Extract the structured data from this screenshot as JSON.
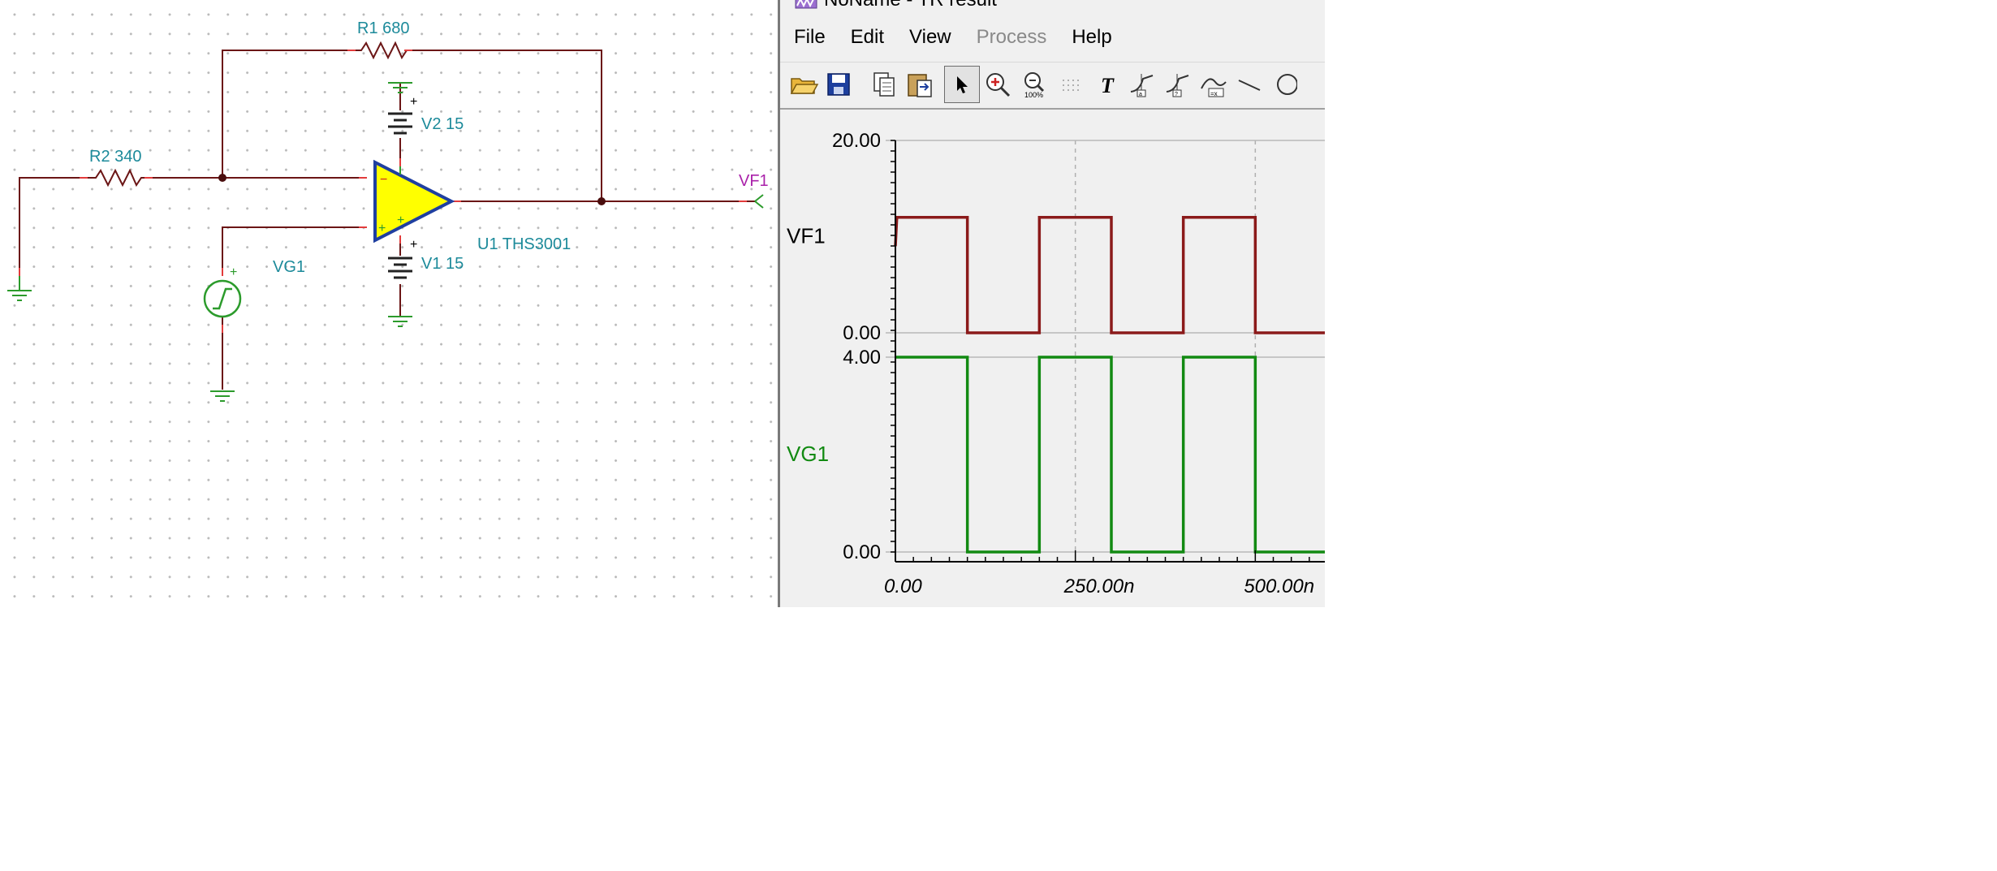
{
  "schematic": {
    "components": {
      "r1": "R1 680",
      "r2": "R2 340",
      "v2": "V2 15",
      "v1": "V1 15",
      "u1": "U1 THS3001",
      "vg1": "VG1",
      "vf1": "VF1"
    }
  },
  "window": {
    "title": "NoName - TR result",
    "menu": [
      {
        "label": "File",
        "enabled": true
      },
      {
        "label": "Edit",
        "enabled": true
      },
      {
        "label": "View",
        "enabled": true
      },
      {
        "label": "Process",
        "enabled": false
      },
      {
        "label": "Help",
        "enabled": true
      }
    ],
    "toolbar": [
      "open-folder-icon",
      "save-icon",
      "copy-icon",
      "paste-icon",
      "pointer-icon",
      "zoom-in-icon",
      "zoom-100-icon",
      "grid-icon",
      "text-icon",
      "cursor-a-icon",
      "cursor-b-icon",
      "cursor-measure-icon",
      "line-icon",
      "circle-icon"
    ]
  },
  "chart_data": {
    "type": "line",
    "xlabel": "",
    "x_tick_labels": [
      "0.00",
      "250.00n",
      "500.00n"
    ],
    "x_ticks": [
      0,
      250,
      500
    ],
    "x_range": [
      0,
      600
    ],
    "series": [
      {
        "name": "VF1",
        "color": "#8b1a1a",
        "y_tick_labels": [
          "0.00",
          "20.00"
        ],
        "ylim": [
          0,
          20
        ],
        "x": [
          0,
          2,
          2,
          100,
          100,
          200,
          200,
          300,
          300,
          400,
          400,
          500,
          500,
          600
        ],
        "y": [
          9,
          12,
          12,
          12,
          0,
          0,
          12,
          12,
          0,
          0,
          12,
          12,
          0,
          0
        ]
      },
      {
        "name": "VG1",
        "color": "#128a12",
        "y_tick_labels": [
          "0.00",
          "4.00"
        ],
        "ylim": [
          0,
          4
        ],
        "x": [
          0,
          100,
          100,
          200,
          200,
          300,
          300,
          400,
          400,
          500,
          500,
          600
        ],
        "y": [
          4,
          4,
          0,
          0,
          4,
          4,
          0,
          0,
          4,
          4,
          0,
          0
        ]
      }
    ],
    "grid_x": true
  },
  "colors": {
    "wire": "#6b1515",
    "ground": "#2c9b2c",
    "label": "#1c8a9a",
    "opamp_fill": "#ffff00",
    "opamp_stroke": "#1f3fa0",
    "vf1_label": "#aa22aa"
  }
}
